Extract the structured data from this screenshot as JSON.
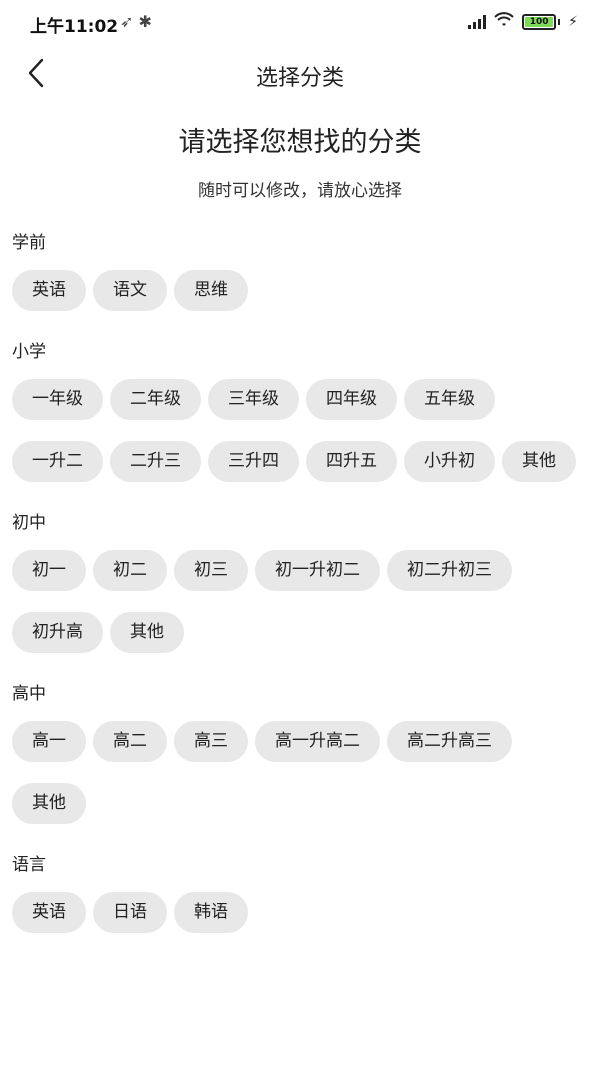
{
  "status_bar": {
    "time": "上午11:02",
    "left_icons": "➶ ✱",
    "battery": "100"
  },
  "nav": {
    "title": "选择分类"
  },
  "header": {
    "title": "请选择您想找的分类",
    "subtitle": "随时可以修改，请放心选择"
  },
  "sections": [
    {
      "title": "学前",
      "chips": [
        "英语",
        "语文",
        "思维"
      ]
    },
    {
      "title": "小学",
      "chips": [
        "一年级",
        "二年级",
        "三年级",
        "四年级",
        "五年级",
        "一升二",
        "二升三",
        "三升四",
        "四升五",
        "小升初",
        "其他"
      ]
    },
    {
      "title": "初中",
      "chips": [
        "初一",
        "初二",
        "初三",
        "初一升初二",
        "初二升初三",
        "初升高",
        "其他"
      ]
    },
    {
      "title": "高中",
      "chips": [
        "高一",
        "高二",
        "高三",
        "高一升高二",
        "高二升高三",
        "其他"
      ]
    },
    {
      "title": "语言",
      "chips": [
        "英语",
        "日语",
        "韩语"
      ]
    }
  ],
  "colors": {
    "chip_bg": "#e8e8e8",
    "battery_fill": "#7ed957"
  }
}
